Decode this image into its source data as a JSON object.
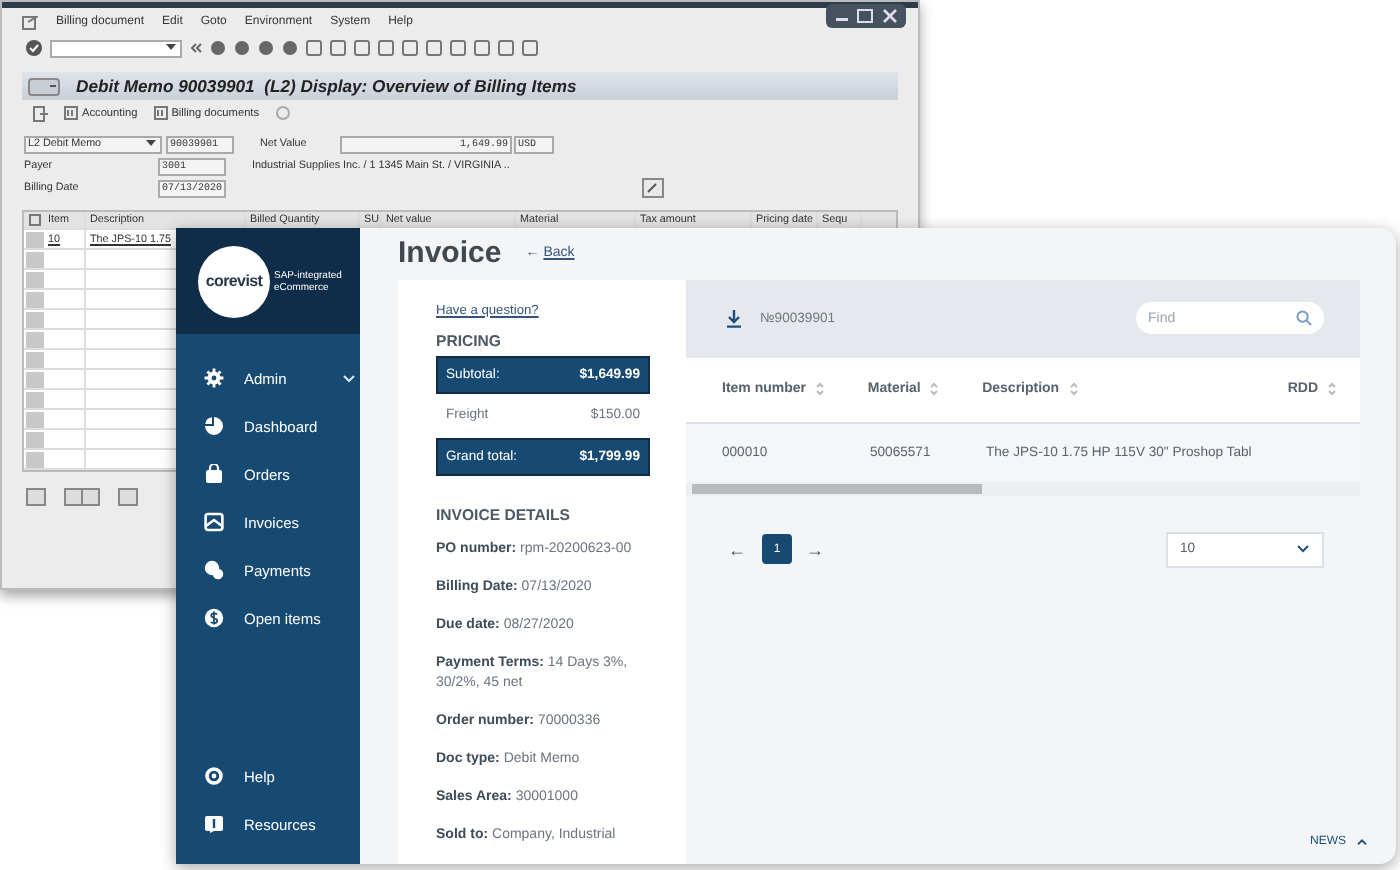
{
  "sap_window": {
    "menu": [
      "Billing document",
      "Edit",
      "Goto",
      "Environment",
      "System",
      "Help"
    ],
    "title": "Debit Memo 90039901  (L2) Display: Overview of Billing Items",
    "app_toolbar": [
      "Accounting",
      "Billing documents"
    ],
    "doc_type": "L2 Debit Memo",
    "doc_number": "90039901",
    "net_value_label": "Net Value",
    "net_value": "1,649.99",
    "currency": "USD",
    "payer_label": "Payer",
    "payer": "3001",
    "payer_text": "Industrial Supplies Inc. / 1 1345 Main St. / VIRGINIA ..",
    "billing_date_label": "Billing Date",
    "billing_date": "07/13/2020",
    "table": {
      "columns": [
        "Item",
        "Description",
        "Billed Quantity",
        "SU",
        "Net value",
        "Material",
        "Tax amount",
        "Pricing date",
        "Sequ"
      ],
      "rows": [
        {
          "item": "10",
          "description": "The JPS-10 1.75"
        }
      ]
    }
  },
  "app": {
    "logo": "corevist",
    "tagline": "SAP-integrated eCommerce",
    "nav": [
      {
        "label": "Admin",
        "kind": "group"
      },
      {
        "label": "Dashboard",
        "kind": "link"
      },
      {
        "label": "Orders",
        "kind": "link"
      },
      {
        "label": "Invoices",
        "kind": "link"
      },
      {
        "label": "Payments",
        "kind": "link"
      },
      {
        "label": "Open items",
        "kind": "link"
      }
    ],
    "nav_bottom": [
      {
        "label": "Help"
      },
      {
        "label": "Resources"
      }
    ],
    "title": "Invoice",
    "back_arrow": "←",
    "back": "Back",
    "question_link": "Have a question?",
    "pricing_title": "PRICING",
    "pricing": [
      {
        "label": "Subtotal:",
        "value": "$1,649.99",
        "highlighted": true
      },
      {
        "label": "Freight",
        "value": "$150.00",
        "highlighted": false
      },
      {
        "label": "Grand total:",
        "value": "$1,799.99",
        "highlighted": true
      }
    ],
    "details_title": "INVOICE DETAILS",
    "details": [
      {
        "label": "PO number:",
        "value": "rpm-20200623-00"
      },
      {
        "label": "Billing Date:",
        "value": "07/13/2020"
      },
      {
        "label": "Due date:",
        "value": "08/27/2020"
      },
      {
        "label": "Payment Terms:",
        "value": "14 Days 3%, 30/2%, 45 net"
      },
      {
        "label": "Order number:",
        "value": "70000336"
      },
      {
        "label": "Doc type:",
        "value": "Debit Memo"
      },
      {
        "label": "Sales Area:",
        "value": "30001000"
      },
      {
        "label": "Sold to:",
        "value": "Company, Industrial"
      }
    ],
    "document_number": "№90039901",
    "search": {
      "placeholder": "Find"
    },
    "table": {
      "columns": [
        "Item number",
        "Material",
        "Description",
        "RDD"
      ],
      "rows": [
        [
          "000010",
          "50065571",
          "The JPS-10 1.75 HP 115V 30\" Proshop Tabl"
        ]
      ]
    },
    "pagination": {
      "prev": "←",
      "next": "→",
      "pages": [
        {
          "label": "1",
          "selected": true
        }
      ]
    },
    "page_size": "10",
    "news": "NEWS"
  }
}
